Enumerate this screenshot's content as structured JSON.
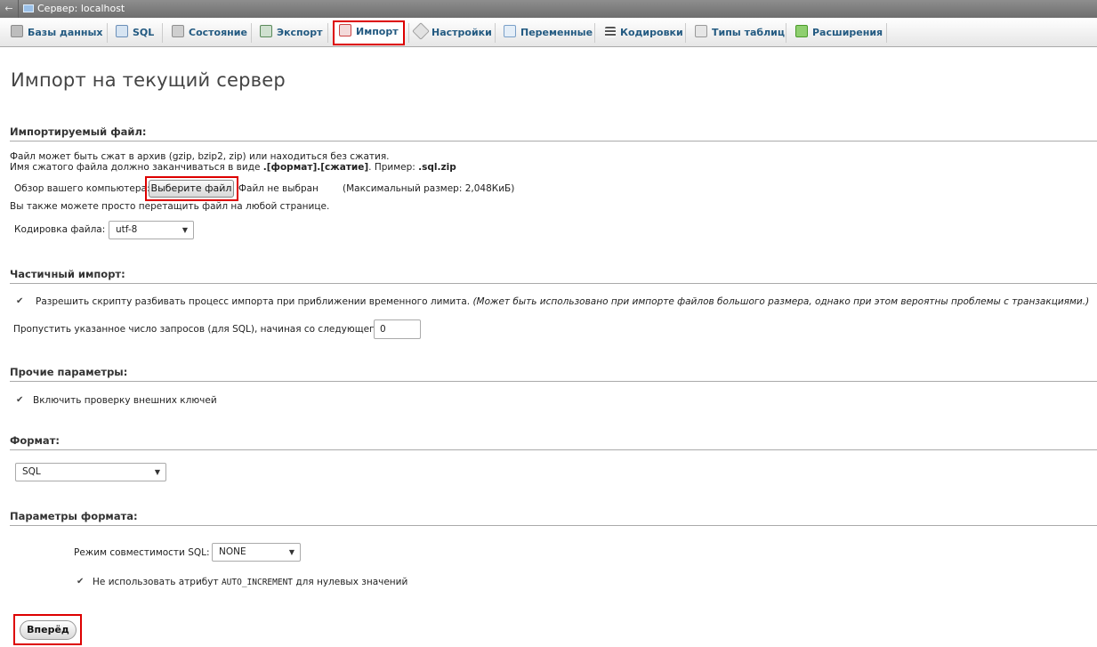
{
  "topbar": {
    "back": "←",
    "crumb": "Сервер: localhost"
  },
  "tabs": [
    {
      "label": "Базы данных",
      "icon": "database-icon",
      "color": "#8a8a8a"
    },
    {
      "label": "SQL",
      "icon": "sql-icon",
      "color": "#6b8fb8"
    },
    {
      "label": "Состояние",
      "icon": "status-icon",
      "color": "#8f8f8f"
    },
    {
      "label": "Экспорт",
      "icon": "export-icon",
      "color": "#5a8a5a"
    },
    {
      "label": "Импорт",
      "icon": "import-icon",
      "color": "#c44"
    },
    {
      "label": "Настройки",
      "icon": "wrench-icon",
      "color": "#a0a0a0"
    },
    {
      "label": "Переменные",
      "icon": "variables-icon",
      "color": "#7aa0c8"
    },
    {
      "label": "Кодировки",
      "icon": "charset-icon",
      "color": "#666"
    },
    {
      "label": "Типы таблиц",
      "icon": "engines-icon",
      "color": "#999"
    },
    {
      "label": "Расширения",
      "icon": "plugin-icon",
      "color": "#4a9a2a"
    }
  ],
  "page_title": "Импорт на текущий сервер",
  "file_section": {
    "title": "Импортируемый файл:",
    "desc1": "Файл может быть сжат в архив (gzip, bzip2, zip) или находиться без сжатия.",
    "desc2_prefix": "Имя сжатого файла должно заканчиваться в виде ",
    "desc2_bold": ".[формат].[сжатие]",
    "desc2_mid": ". Пример: ",
    "desc2_example": ".sql.zip",
    "browse_label": "Обзор вашего компьютера:",
    "choose_button": "Выберите файл",
    "no_file": "Файл не выбран",
    "max_size": "(Максимальный размер: 2,048КиБ)",
    "drag_hint": "Вы также можете просто перетащить файл на любой странице.",
    "charset_label": "Кодировка файла:",
    "charset_value": "utf-8"
  },
  "partial_section": {
    "title": "Частичный импорт:",
    "allow_interrupt": "Разрешить скрипту разбивать процесс импорта при приближении временного лимита.",
    "allow_interrupt_note": "(Может быть использовано при импорте файлов большого размера, однако при этом вероятны проблемы с транзакциями.)",
    "skip_label": "Пропустить указанное число запросов (для SQL), начиная со следующего:",
    "skip_value": "0"
  },
  "other_section": {
    "title": "Прочие параметры:",
    "fk_checks": "Включить проверку внешних ключей"
  },
  "format_section": {
    "title": "Формат:",
    "format_value": "SQL"
  },
  "format_options": {
    "title": "Параметры формата:",
    "compat_label": "Режим совместимости SQL:",
    "compat_value": "NONE",
    "no_auto_prefix": "Не использовать атрибут ",
    "no_auto_code": "AUTO_INCREMENT",
    "no_auto_suffix": " для нулевых значений"
  },
  "go_button": "Вперёд",
  "colors": {
    "accent_red": "#dd0000",
    "link_blue": "#235a81"
  }
}
